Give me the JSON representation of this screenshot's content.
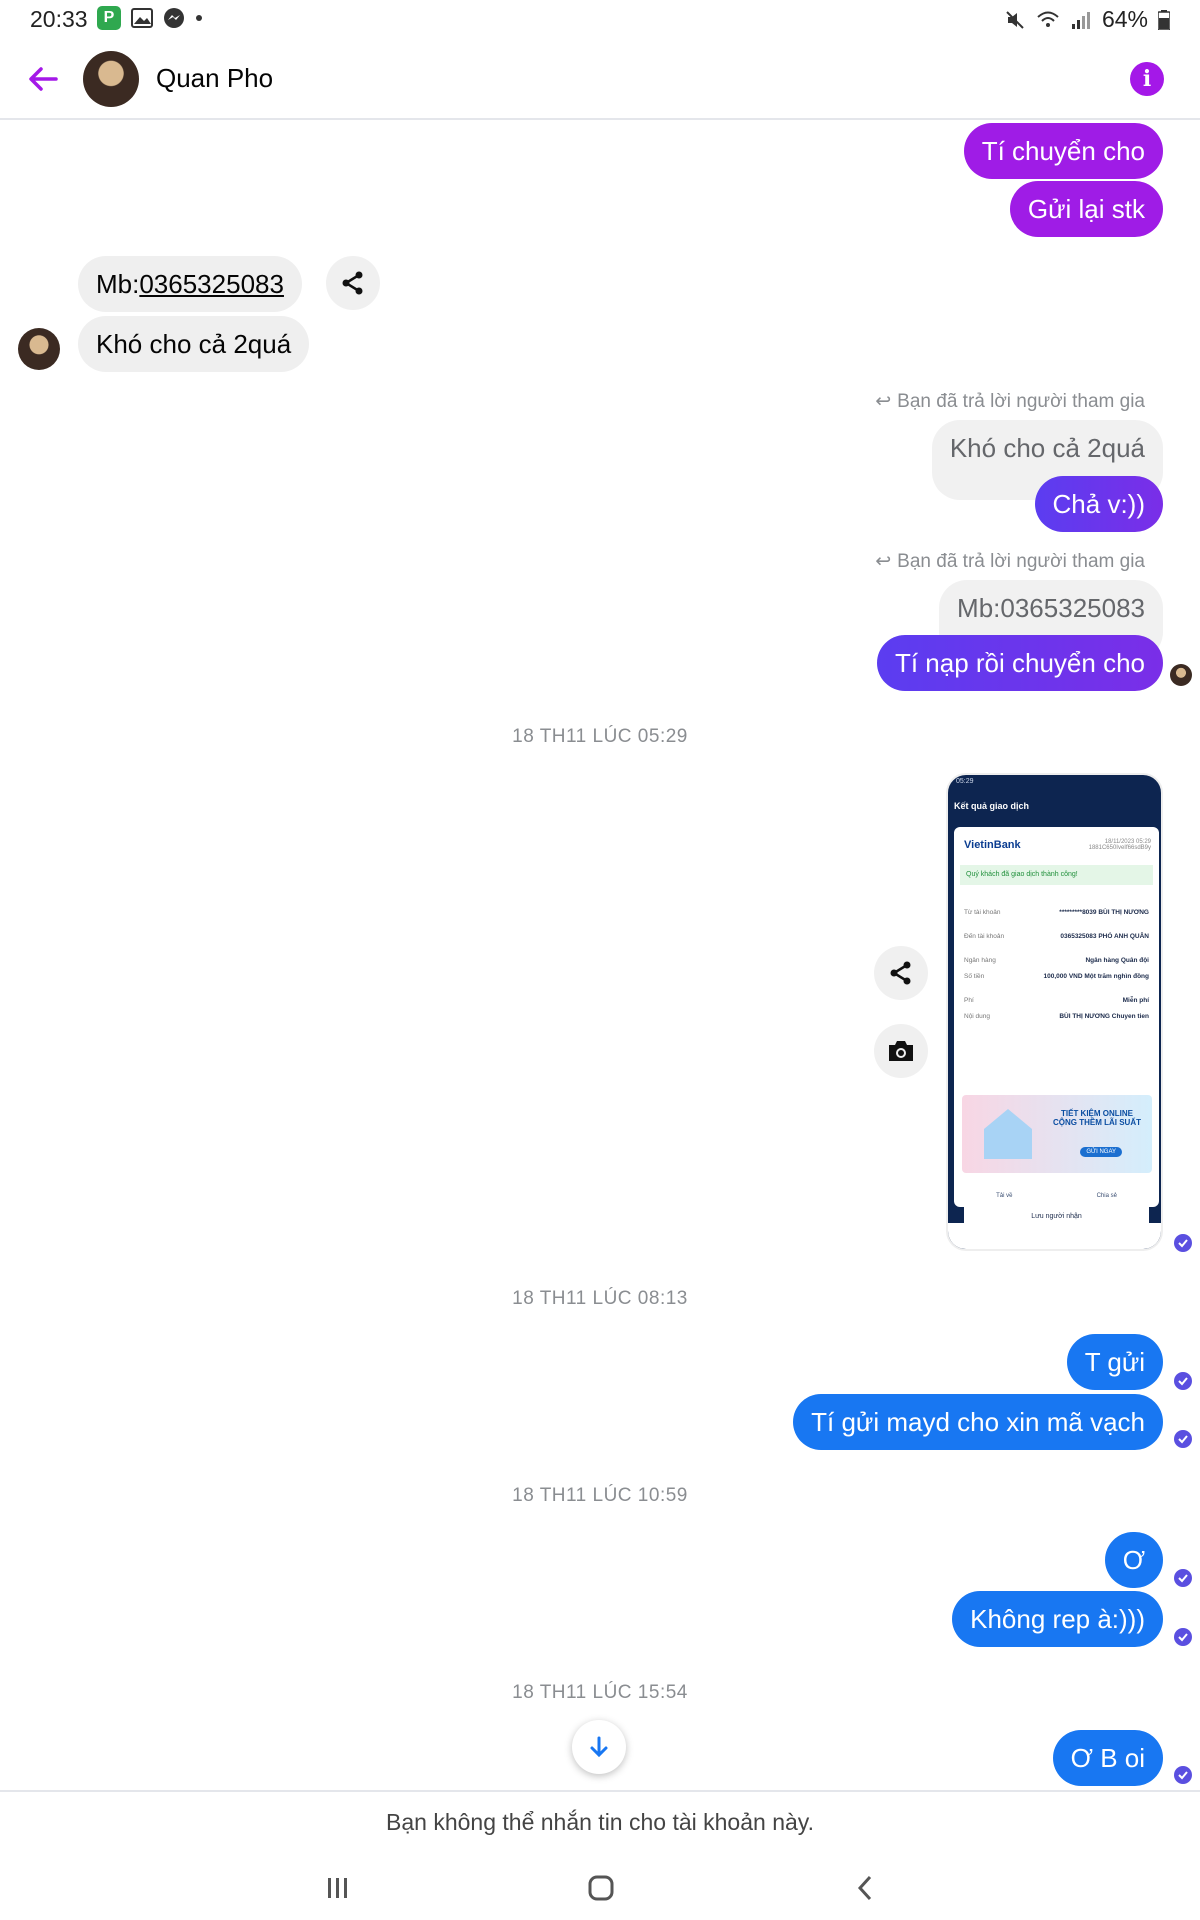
{
  "status_bar": {
    "time": "20:33",
    "battery": "64%"
  },
  "header": {
    "contact_name": "Quan Pho"
  },
  "messages": {
    "m1": "Tí chuyển cho",
    "m2": "Gửi lại stk",
    "m3_prefix": "Mb:",
    "m3_number": "0365325083",
    "m4": "Khó cho cả 2quá",
    "reply1_label": "Bạn đã trả lời người tham gia",
    "reply1_quote": "Khó cho cả 2quá",
    "reply1_text": "Chả v:))",
    "reply2_label": "Bạn đã trả lời người tham gia",
    "reply2_quote": "Mb:0365325083",
    "reply2_text": "Tí nạp rồi chuyển cho",
    "ts1": "18 TH11 LÚC 05:29",
    "ts2": "18 TH11 LÚC 08:13",
    "m5": "T gửi",
    "m6": "Tí gửi mayd cho xin mã vạch",
    "ts3": "18 TH11 LÚC 10:59",
    "m7": "Ơ",
    "m8": "Không rep à:)))",
    "ts4": "18 TH11 LÚC 15:54",
    "m9": "Ơ B oi"
  },
  "receipt_image": {
    "status_time": "05:29",
    "title": "Kết quả giao dịch",
    "bank": "VietinBank",
    "date": "18/11/2023 05:29",
    "ref": "1881C650IveIf66sdB9y",
    "success_text": "Quý khách đã giao dịch thành công!",
    "rows": [
      {
        "label": "Từ tài khoản",
        "value": "*********8039 BÙI THỊ NƯƠNG"
      },
      {
        "label": "Đến tài khoản",
        "value": "0365325083 PHÓ ANH QUÂN"
      },
      {
        "label": "Ngân hàng",
        "value": "Ngân hàng Quân đội"
      },
      {
        "label": "Số tiền",
        "value": "100,000 VND Một trăm nghìn đồng"
      },
      {
        "label": "Phí",
        "value": "Miễn phí"
      },
      {
        "label": "Nội dung",
        "value": "BÙI THỊ NƯƠNG Chuyen tien"
      }
    ],
    "promo_title": "TIẾT KIỆM ONLINE CỘNG THÊM LÃI SUẤT",
    "promo_button": "GỬI NGAY",
    "download": "Tải về",
    "share": "Chia sẻ",
    "save_recipient": "Lưu người nhận"
  },
  "footer": {
    "blocked_text": "Bạn không thể nhắn tin cho tài khoản này."
  },
  "colors": {
    "purple": "#9f1ce6",
    "blue": "#1877f2",
    "accent": "#a418e8"
  }
}
